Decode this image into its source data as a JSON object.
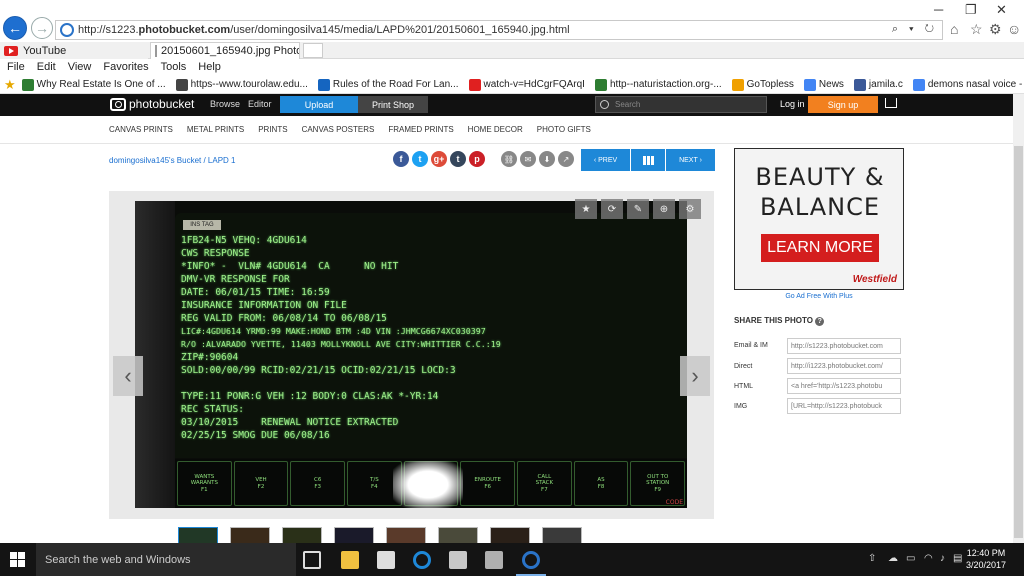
{
  "browser": {
    "url": "http://s1223.photobucket.com/user/domingosilva145/media/LAPD%201/20150601_165940.jpg.html",
    "url_prefix": "http://s1223.",
    "url_domain": "photobucket.com",
    "url_suffix": "/user/domingosilva145/media/LAPD%201/20150601_165940.jpg.html",
    "address_controls": "⌕ ▾ ↻",
    "tabs": [
      {
        "label": "YouTube",
        "active": false
      },
      {
        "label": "20150601_165940.jpg Photo ...",
        "active": true
      }
    ],
    "menu": [
      "File",
      "Edit",
      "View",
      "Favorites",
      "Tools",
      "Help"
    ],
    "favorites": [
      {
        "label": "Why Real Estate Is One of ...",
        "color": "#2e7d32"
      },
      {
        "label": "https--www.tourolaw.edu...",
        "color": "#444"
      },
      {
        "label": "Rules of the Road For Lan...",
        "color": "#1565c0"
      },
      {
        "label": "watch-v=HdCgrFQArqI",
        "color": "#e02020"
      },
      {
        "label": "http--naturistaction.org-...",
        "color": "#2e7d32"
      },
      {
        "label": "GoTopless",
        "color": "#f0a000"
      },
      {
        "label": "News",
        "color": "#4285f4"
      },
      {
        "label": "jamila.c",
        "color": "#3b5998"
      },
      {
        "label": "demons nasal voice - Goo...",
        "color": "#4285f4"
      }
    ]
  },
  "photobucket": {
    "logo": "photobucket",
    "nav": [
      "Browse",
      "Editor"
    ],
    "upload": "Upload",
    "print_shop": "Print Shop",
    "search_placeholder": "Search",
    "login": "Log in",
    "signup": "Sign up",
    "categories": [
      "CANVAS PRINTS",
      "METAL PRINTS",
      "PRINTS",
      "CANVAS POSTERS",
      "FRAMED PRINTS",
      "HOME DECOR",
      "PHOTO GIFTS"
    ],
    "breadcrumb": "domingosilva145's Bucket / LAPD 1",
    "prev": "‹ PREV",
    "next": "NEXT ›",
    "social": [
      {
        "name": "facebook",
        "glyph": "f",
        "color": "#3b5998"
      },
      {
        "name": "twitter",
        "glyph": "t",
        "color": "#1da1f2"
      },
      {
        "name": "google-plus",
        "glyph": "g+",
        "color": "#dd4b39"
      },
      {
        "name": "tumblr",
        "glyph": "t",
        "color": "#35465c"
      },
      {
        "name": "pinterest",
        "glyph": "p",
        "color": "#cb2027"
      }
    ]
  },
  "photo": {
    "screen_tag": "INS TAG",
    "terminal_lines": [
      "1FB24-N5 VEHQ: 4GDU614",
      "CWS RESPONSE",
      "*INFO* -  VLN# 4GDU614  CA      NO HIT",
      "DMV-VR RESPONSE FOR",
      "DATE: 06/01/15 TIME: 16:59",
      "INSURANCE INFORMATION ON FILE",
      "REG VALID FROM: 06/08/14 TO 06/08/15",
      "LIC#:4GDU614 YRMD:99 MAKE:HOND BTM :4D VIN :JHMCG6674XC030397",
      "R/O :ALVARADO YVETTE, 11403 MOLLYKNOLL AVE CITY:WHITTIER C.C.:19",
      "ZIP#:90604",
      "SOLD:00/00/99 RCID:02/21/15 OCID:02/21/15 LOCD:3",
      "",
      "TYPE:11 PONR:G VEH :12 BODY:0 CLAS:AK *-YR:14",
      "REC STATUS:",
      "03/10/2015    RENEWAL NOTICE EXTRACTED",
      "02/25/15 SMOG DUE 06/08/16"
    ],
    "fkeys": [
      "WANTS\nWARANTS\nF1",
      "VEH\nF2",
      "C6\nF3",
      "T/S\nF4",
      "",
      "ENROUTE\nF6",
      "CALL\nSTACK\nF7",
      "AS\nF8",
      "OUT TO\nSTATION\nF9"
    ],
    "code_label": "CODE"
  },
  "ad": {
    "line1": "BEAUTY &",
    "line2": "BALANCE",
    "cta": "LEARN MORE",
    "brand": "Westfield",
    "ad_free": "Go Ad Free With Plus"
  },
  "share": {
    "title": "SHARE THIS PHOTO",
    "rows": [
      {
        "label": "Email & IM",
        "value": "http://s1223.photobucket.com"
      },
      {
        "label": "Direct",
        "value": "http://i1223.photobucket.com/"
      },
      {
        "label": "HTML",
        "value": "<a href='http://s1223.photobu"
      },
      {
        "label": "IMG",
        "value": "[URL=http://s1223.photobuck"
      }
    ]
  },
  "taskbar": {
    "search_placeholder": "Search the web and Windows",
    "time": "12:40 PM",
    "date": "3/20/2017"
  }
}
